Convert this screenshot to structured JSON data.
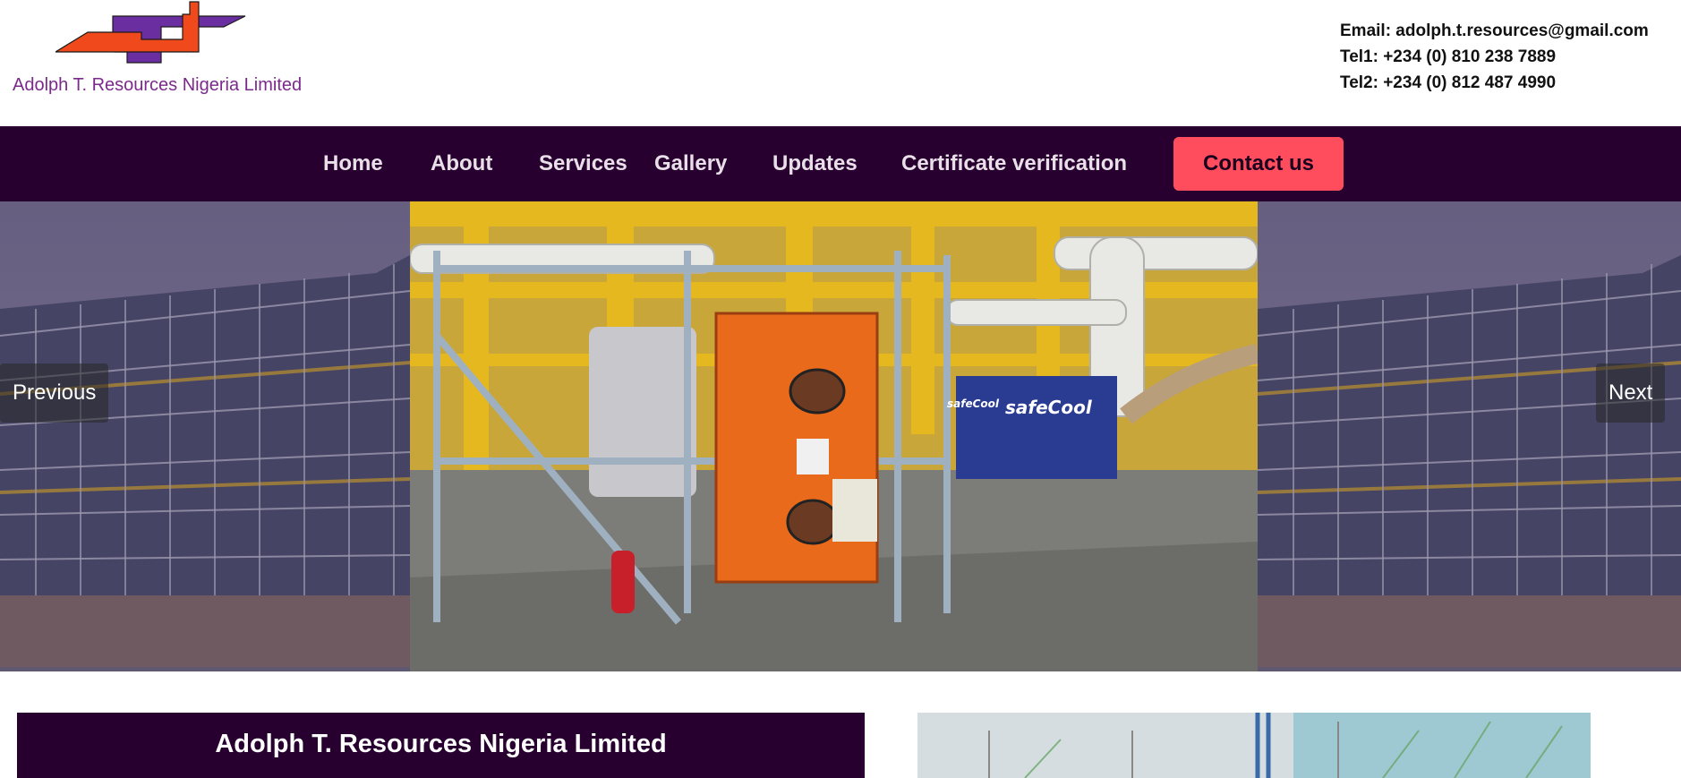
{
  "header": {
    "company_name": "Adolph T. Resources Nigeria Limited",
    "email": "Email: adolph.t.resources@gmail.com",
    "tel1": "Tel1: +234 (0) 810 238 7889",
    "tel2": "Tel2: +234 (0) 812 487 4990",
    "logo_icon": "company-logo-icon"
  },
  "nav": {
    "items": [
      "Home",
      "About",
      "Services",
      "Gallery",
      "Updates",
      "Certificate verification"
    ],
    "contact_label": "Contact us"
  },
  "carousel": {
    "prev_label": "Previous",
    "next_label": "Next",
    "center_slide_text": "safeCool",
    "center_slide_text_2": "safeCool"
  },
  "about": {
    "title": "Adolph T. Resources Nigeria Limited"
  },
  "colors": {
    "nav_bg": "#27002f",
    "accent_button": "#ff4d5e",
    "company_name": "#7b2a8c",
    "logo_orange": "#f04a1c",
    "logo_purple": "#6a2ea0"
  }
}
